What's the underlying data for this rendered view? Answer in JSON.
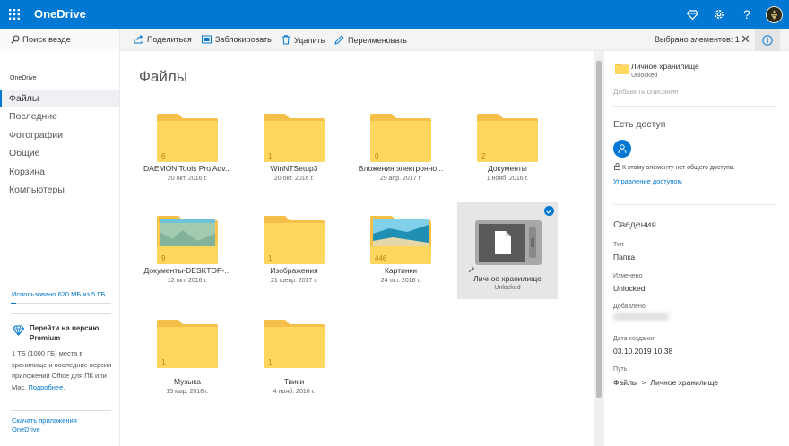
{
  "app": {
    "brand": "OneDrive"
  },
  "topbar": {
    "icons": [
      "waffle-icon",
      "diamond-icon",
      "gear-icon",
      "help-icon",
      "avatar"
    ],
    "help_label": "?"
  },
  "search": {
    "label": "Поиск везде",
    "icon": "search-icon"
  },
  "commands": [
    {
      "label": "Поделиться",
      "icon": "share-icon"
    },
    {
      "label": "Заблокировать",
      "icon": "lock-icon"
    },
    {
      "label": "Удалить",
      "icon": "delete-icon"
    },
    {
      "label": "Переименовать",
      "icon": "rename-icon"
    }
  ],
  "selection": {
    "label": "Выбрано элементов: 1",
    "close": "✕",
    "info_icon": "info-icon"
  },
  "sidebar": {
    "heading": "OneDrive",
    "items": [
      {
        "label": "Файлы"
      },
      {
        "label": "Последние"
      },
      {
        "label": "Фотографии"
      },
      {
        "label": "Общие"
      },
      {
        "label": "Корзина"
      },
      {
        "label": "Компьютеры"
      }
    ],
    "storage": "Использовано 620 МБ из 5 ГБ",
    "storage_used_fraction": 0.12,
    "premium_title": "Перейти на версию Premium",
    "premium_body": "1 ТБ (1000 ГБ) места в хранилище и последние версии приложений Office для ПК или Mac.",
    "premium_link": "Подробнее.",
    "get_apps": "Скачать приложения OneDrive"
  },
  "main": {
    "title": "Файлы",
    "folders": [
      {
        "name": "DAEMON Tools Pro Adv...",
        "date": "20 окт. 2016 г.",
        "count": "6"
      },
      {
        "name": "WinNTSetup3",
        "date": "20 окт. 2016 г.",
        "count": "1"
      },
      {
        "name": "Вложения электронно...",
        "date": "29 апр. 2017 г.",
        "count": "0"
      },
      {
        "name": "Документы",
        "date": "1 нояб. 2016 г.",
        "count": "2"
      },
      {
        "name": "Документы-DESKTOP-...",
        "date": "12 окт. 2016 г.",
        "count": "9"
      },
      {
        "name": "Изображения",
        "date": "21 февр. 2017 г.",
        "count": "1"
      },
      {
        "name": "Картинки",
        "date": "24 окт. 2016 г.",
        "count": "446"
      },
      {
        "name": "Личное хранилище",
        "date": "Unlocked",
        "count": ""
      },
      {
        "name": "Музыка",
        "date": "15 мар. 2018 г.",
        "count": "1"
      },
      {
        "name": "Твики",
        "date": "4 нояб. 2016 г.",
        "count": "1"
      }
    ]
  },
  "panel": {
    "name": "Личное хранилище",
    "status": "Unlocked",
    "add_description": "Добавить описание",
    "access_heading": "Есть доступ",
    "no_share": "К этому элементу нет общего доступа.",
    "manage_access": "Управление доступом",
    "details_heading": "Сведения",
    "type_label": "Тип",
    "type_value": "Папка",
    "modified_label": "Изменено",
    "modified_value": "Unlocked",
    "added_label": "Добавлено",
    "created_label": "Дата создания",
    "created_value": "03.10.2019 10:38",
    "path_label": "Путь",
    "path_value": "Файлы  >  Личное хранилище"
  },
  "colors": {
    "accent": "#0078d4",
    "folder": "#ffd75e",
    "folder_dark": "#f5c04a"
  }
}
